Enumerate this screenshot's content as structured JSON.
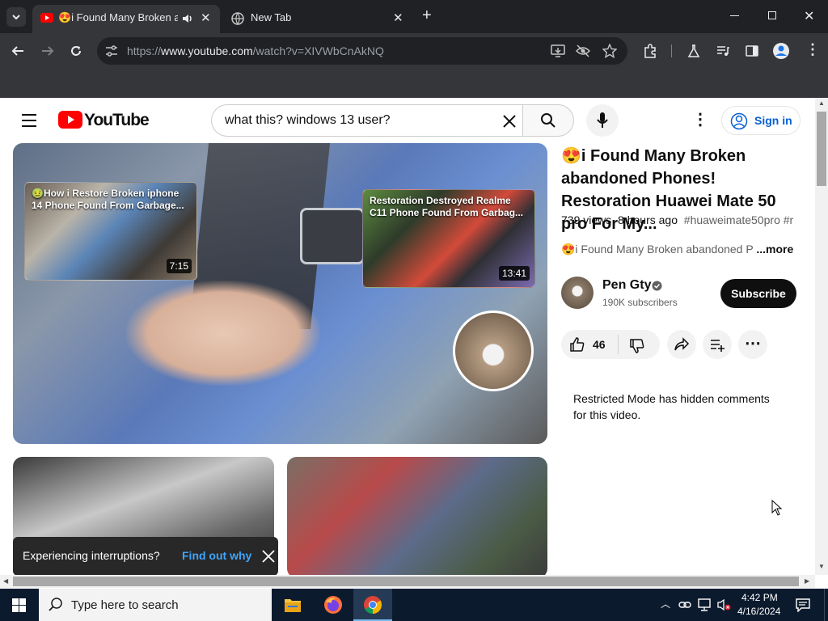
{
  "browser": {
    "tabs": [
      {
        "label": "😍i Found Many Broken ab",
        "active": true
      },
      {
        "label": "New Tab",
        "active": false
      }
    ],
    "url_prefix": "https://",
    "url_domain": "www.youtube.com",
    "url_path": "/watch?v=XIVWbCnAkNQ"
  },
  "youtube": {
    "logo_text": "YouTube",
    "search_value": "what this? windows 13 user?",
    "signin_label": "Sign in",
    "player": {
      "card1": {
        "title": "🤢How i Restore Broken iphone 14 Phone Found From Garbage...",
        "duration": "7:15"
      },
      "card2": {
        "title": "Restoration Destroyed Realme C11 Phone Found From Garbag...",
        "duration": "13:41"
      }
    },
    "video": {
      "title": "😍i Found Many Broken abandoned Phones! Restoration Huawei Mate 50 pro For My...",
      "views": "739 views",
      "age": "8 hours ago",
      "hashtags": "#huaweimate50pro #r",
      "description": "😍i Found Many Broken abandoned P",
      "more": "...more"
    },
    "channel": {
      "name": "Pen Gty",
      "subscribers": "190K subscribers",
      "subscribe_label": "Subscribe"
    },
    "actions": {
      "likes": "46"
    },
    "comments_notice": "Restricted Mode has hidden comments for this video.",
    "toast": {
      "text": "Experiencing interruptions?",
      "link": "Find out why"
    }
  },
  "taskbar": {
    "search_placeholder": "Type here to search",
    "time": "4:42 PM",
    "date": "4/16/2024"
  },
  "colors": {
    "yt_red": "#ff0000",
    "link_blue": "#065fd4",
    "chrome_dark": "#202124",
    "taskbar": "#0c1a2e"
  }
}
